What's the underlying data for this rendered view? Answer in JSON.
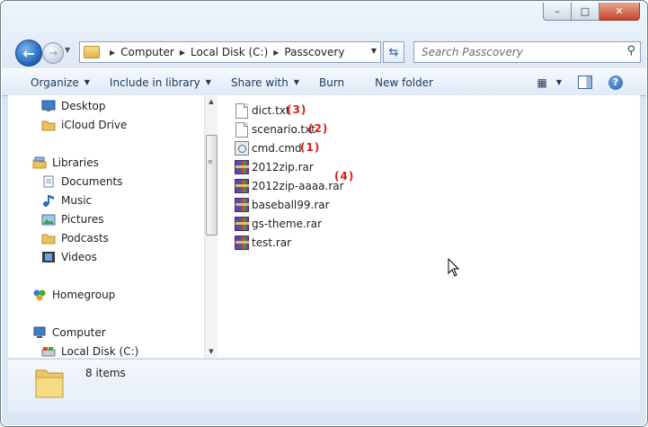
{
  "window": {
    "controls": {
      "minimize": "–",
      "maximize": "□",
      "close": "✕"
    }
  },
  "nav": {
    "breadcrumb": [
      "Computer",
      "Local Disk (C:)",
      "Passcovery"
    ],
    "search_placeholder": "Search Passcovery"
  },
  "toolbar": {
    "organize": "Organize",
    "include": "Include in library",
    "share": "Share with",
    "burn": "Burn",
    "new_folder": "New folder"
  },
  "sidebar": {
    "items": [
      {
        "label": "Desktop",
        "icon": "desktop-icon"
      },
      {
        "label": "iCloud Drive",
        "icon": "folder-icon"
      },
      {
        "label": "Libraries",
        "icon": "libraries-icon"
      },
      {
        "label": "Documents",
        "icon": "documents-icon"
      },
      {
        "label": "Music",
        "icon": "music-icon"
      },
      {
        "label": "Pictures",
        "icon": "pictures-icon"
      },
      {
        "label": "Podcasts",
        "icon": "folder-icon"
      },
      {
        "label": "Videos",
        "icon": "videos-icon"
      },
      {
        "label": "Homegroup",
        "icon": "homegroup-icon"
      },
      {
        "label": "Computer",
        "icon": "computer-icon"
      },
      {
        "label": "Local Disk (C:)",
        "icon": "drive-icon"
      }
    ]
  },
  "files": [
    {
      "name": "dict.txt",
      "icon": "text-file-icon"
    },
    {
      "name": "scenario.txt",
      "icon": "text-file-icon"
    },
    {
      "name": "cmd.cmd",
      "icon": "cmd-file-icon"
    },
    {
      "name": "2012zip.rar",
      "icon": "rar-archive-icon"
    },
    {
      "name": "2012zip-aaaa.rar",
      "icon": "rar-archive-icon"
    },
    {
      "name": "baseball99.rar",
      "icon": "rar-archive-icon"
    },
    {
      "name": "gs-theme.rar",
      "icon": "rar-archive-icon"
    },
    {
      "name": "test.rar",
      "icon": "rar-archive-icon"
    }
  ],
  "annotations": [
    "(3)",
    "(2)",
    "(1)",
    "(4)"
  ],
  "annotation_color": "#e01a1a",
  "status": {
    "item_count": "8 items"
  }
}
